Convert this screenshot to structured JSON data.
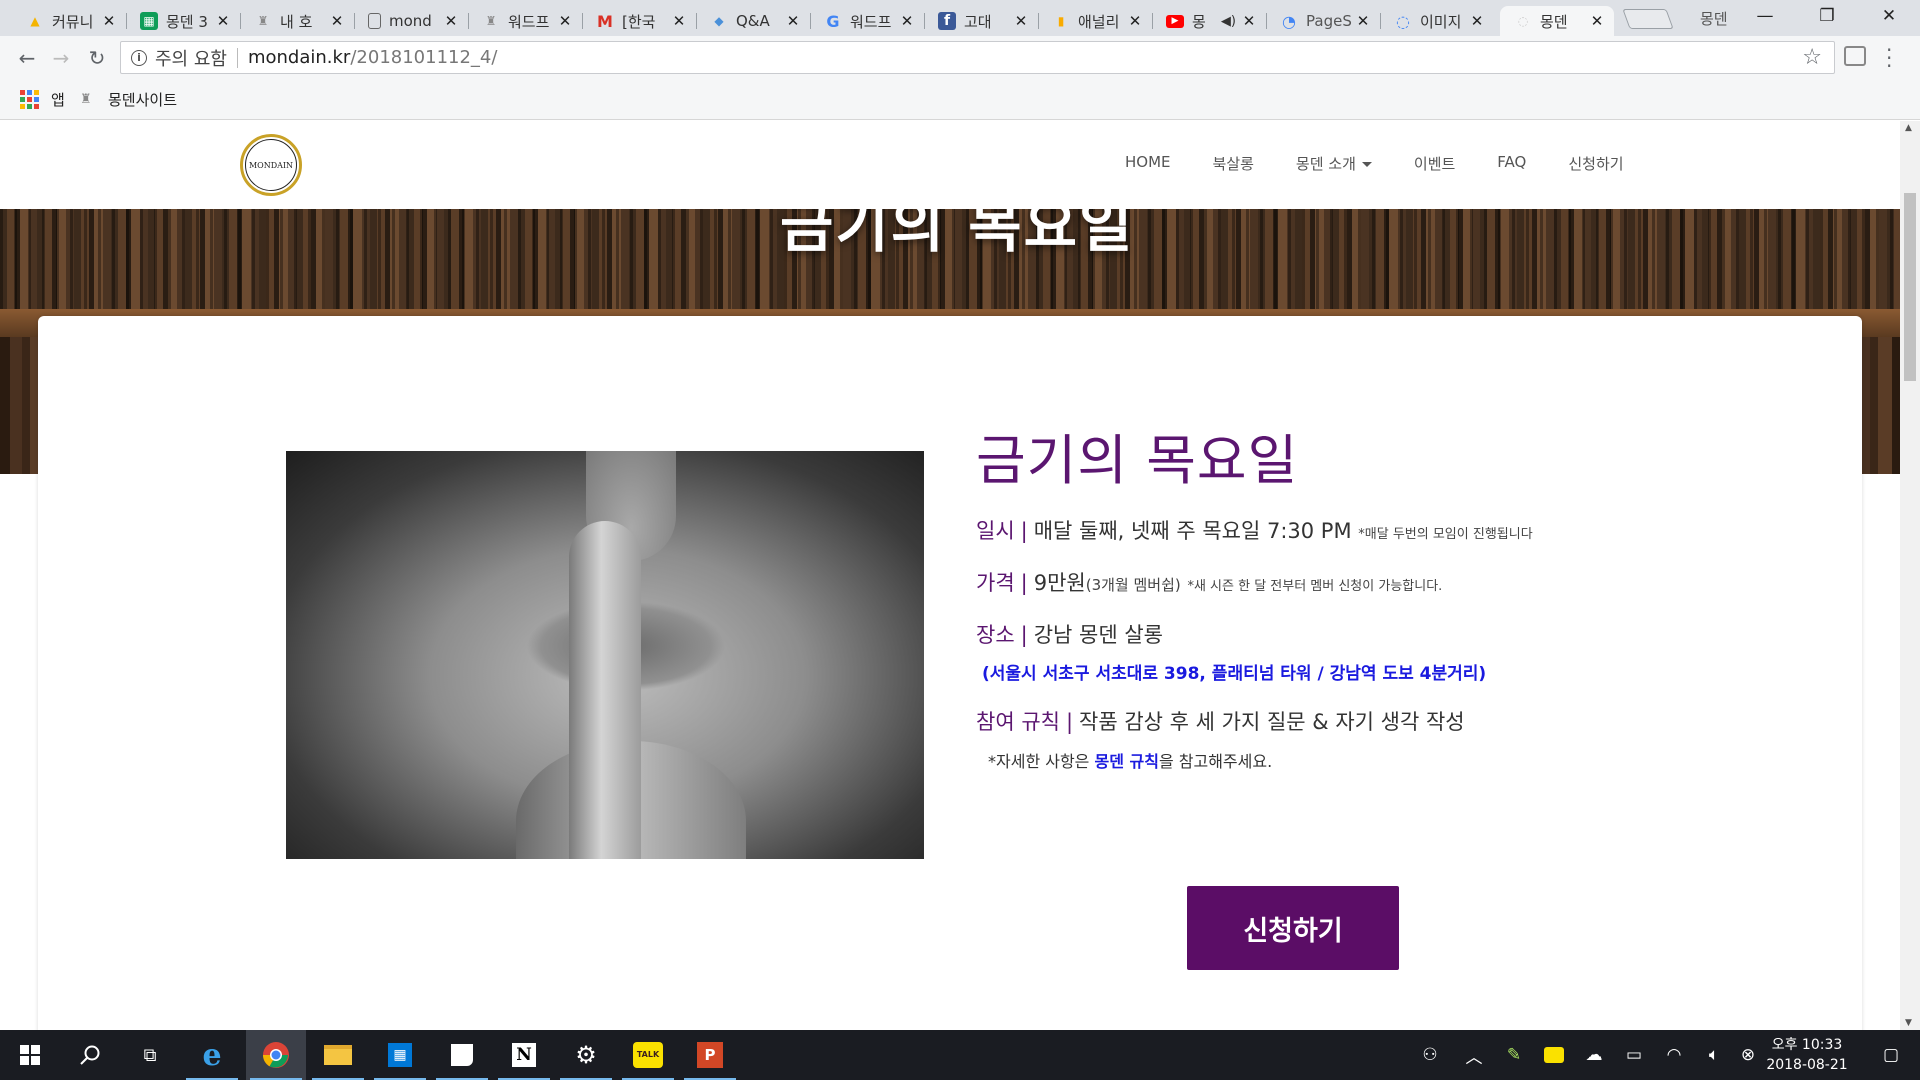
{
  "browser": {
    "tabs": [
      {
        "title": "커뮤니",
        "icon": "google-drive-icon",
        "color": "#f4b400"
      },
      {
        "title": "몽덴 3",
        "icon": "google-sheets-icon",
        "color": "#0f9d58"
      },
      {
        "title": "내 호",
        "icon": "mondain-site-icon",
        "color": "#888888"
      },
      {
        "title": "mond",
        "icon": "document-icon",
        "color": "#666666"
      },
      {
        "title": "워드프",
        "icon": "mondain-site-icon",
        "color": "#888888"
      },
      {
        "title": "[한국",
        "icon": "gmail-icon",
        "color": "#d93025"
      },
      {
        "title": "Q&A",
        "icon": "naver-blog-icon",
        "color": "#4a90d9"
      },
      {
        "title": "워드프",
        "icon": "google-icon",
        "color": "#4285f4"
      },
      {
        "title": "고대",
        "icon": "facebook-icon",
        "color": "#3b5998"
      },
      {
        "title": "애널리",
        "icon": "analytics-icon",
        "color": "#f9ab00"
      },
      {
        "title": "몽",
        "icon": "youtube-icon",
        "color": "#ff0000"
      },
      {
        "title": "PageS",
        "icon": "pagespeed-icon",
        "color": "#4285f4"
      },
      {
        "title": "이미지",
        "icon": "google-icon",
        "color": "#4285f4"
      },
      {
        "title": "몽덴",
        "icon": "page-icon",
        "color": "#cccccc"
      }
    ],
    "profile": "몽덴",
    "address": {
      "security_label": "주의 요함",
      "host": "mondain.kr",
      "path": "/2018101112_4/"
    },
    "bookmarks": [
      {
        "label": "앱",
        "icon": "apps-grid-icon"
      },
      {
        "label": "몽덴사이트",
        "icon": "mondain-site-icon"
      }
    ]
  },
  "site": {
    "logo_text": "MONDAIN",
    "nav": [
      {
        "label": "HOME"
      },
      {
        "label": "북살롱"
      },
      {
        "label": "몽덴 소개",
        "dropdown": true
      },
      {
        "label": "이벤트"
      },
      {
        "label": "FAQ"
      },
      {
        "label": "신청하기"
      }
    ],
    "hero_title": "금기의 목요일"
  },
  "event": {
    "title": "금기의 목요일",
    "schedule": {
      "label": "일시",
      "value": "매달 둘째, 넷째 주 목요일 7:30 PM",
      "note": "*매달 두번의 모임이 진행됩니다"
    },
    "price": {
      "label": "가격",
      "value": "9만원",
      "sub": "(3개월 멤버쉽)",
      "note": "*새 시즌 한 달 전부터 멤버 신청이 가능합니다."
    },
    "place": {
      "label": "장소",
      "value": "강남 몽덴 살롱",
      "address": "서울시 서초구 서초대로 398, 플래티넘 타워 / 강남역 도보 4분거리"
    },
    "rules": {
      "label": "참여 규칙",
      "value": "작품 감상 후 세 가지 질문 & 자기 생각 작성",
      "note_prefix": "*자세한 사항은 ",
      "note_link": "몽덴 규칙",
      "note_suffix": "을 참고해주세요."
    },
    "apply_button": "신청하기"
  },
  "taskbar": {
    "time_period": "오후",
    "time": "10:33",
    "date": "2018-08-21",
    "apps": [
      "start-icon",
      "search-icon",
      "task-view-icon",
      "internet-explorer-icon",
      "chrome-icon",
      "file-explorer-icon",
      "store-icon",
      "sticky-notes-icon",
      "notion-icon",
      "settings-icon",
      "kakaotalk-icon",
      "powerpoint-icon"
    ]
  }
}
